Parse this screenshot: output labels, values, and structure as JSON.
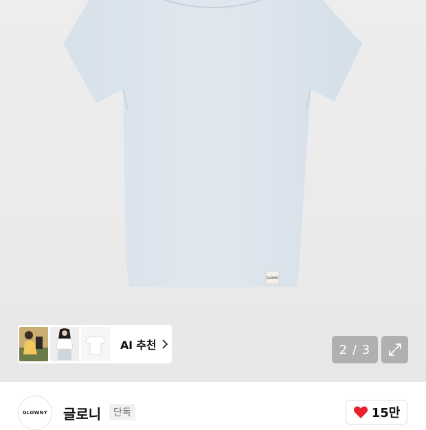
{
  "product": {
    "image_alt": "light blue short sleeve t-shirt",
    "label_text": "GLOWNY",
    "shirt_color": "#dbe4ec"
  },
  "ai_recommend": {
    "label": "AI 추천",
    "thumbnails": [
      "model-photo-1",
      "model-photo-2",
      "tshirt-flat"
    ]
  },
  "pager": {
    "text": "2 / 3"
  },
  "brand": {
    "logo_text": "GLOWNY",
    "name": "글로니",
    "badge": "단독"
  },
  "likes": {
    "count": "15만",
    "heart_color": "#e8212f"
  }
}
